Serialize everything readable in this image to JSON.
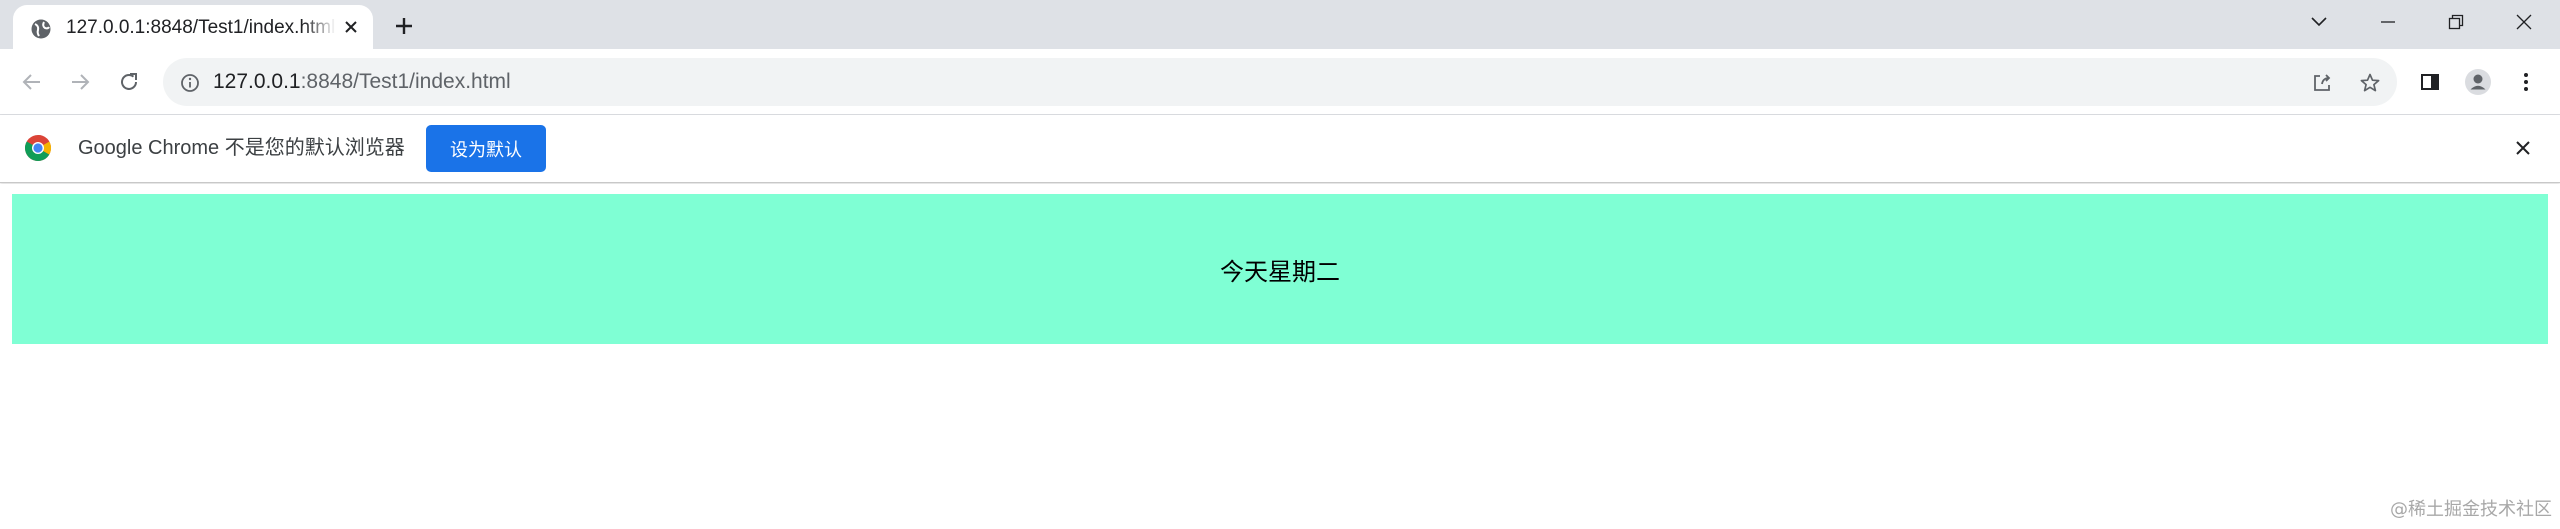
{
  "tab": {
    "title": "127.0.0.1:8848/Test1/index.html",
    "favicon": "globe-icon"
  },
  "window_controls": [
    "chevron-down-icon",
    "minimize-icon",
    "restore-icon",
    "close-icon"
  ],
  "toolbar": {
    "url_host": "127.0.0.1",
    "url_path": ":8848/Test1/index.html",
    "icons": [
      "back-icon",
      "forward-icon",
      "reload-icon",
      "info-icon",
      "share-icon",
      "star-icon",
      "side-panel-icon",
      "profile-icon",
      "menu-icon"
    ]
  },
  "infobar": {
    "message": "Google Chrome 不是您的默认浏览器",
    "button_label": "设为默认",
    "button_color": "#1a73e8"
  },
  "page": {
    "banner_text": "今天星期二",
    "banner_color": "#7fffd4",
    "watermark": "@稀土掘金技术社区"
  }
}
